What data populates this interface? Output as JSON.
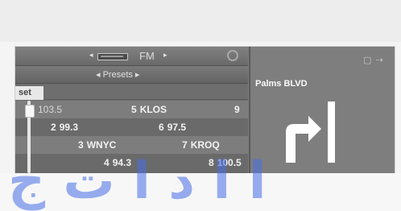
{
  "radio": {
    "band": "FM",
    "presets_label": "Presets",
    "set_tab": "set",
    "presets": [
      {
        "col1": {
          "num": "",
          "label": "103.5"
        },
        "col2": {
          "num": "5",
          "label": "KLOS"
        },
        "col3": {
          "num": "9",
          "label": ""
        }
      },
      {
        "col1": {
          "num": "2",
          "label": "99.3"
        },
        "col2": {
          "num": "6",
          "label": "97.5"
        },
        "col3": {
          "num": "",
          "label": ""
        }
      },
      {
        "col1": {
          "num": "3",
          "label": "WNYC"
        },
        "col2": {
          "num": "7",
          "label": "KROQ"
        },
        "col3": {
          "num": "",
          "label": ""
        }
      },
      {
        "col1": {
          "num": "4",
          "label": "94.3"
        },
        "col2": {
          "num": "8",
          "label": "100.5"
        },
        "col3": {
          "num": "",
          "label": ""
        }
      }
    ]
  },
  "navigation": {
    "street": "Palms BLVD",
    "maneuver": "right-turn-arrow-icon",
    "icons": [
      "screen-toggle-icon"
    ]
  },
  "colors": {
    "screen_bg": "#7c7c7c",
    "text": "#f2f2f2",
    "watermark": "#466ee6"
  }
}
